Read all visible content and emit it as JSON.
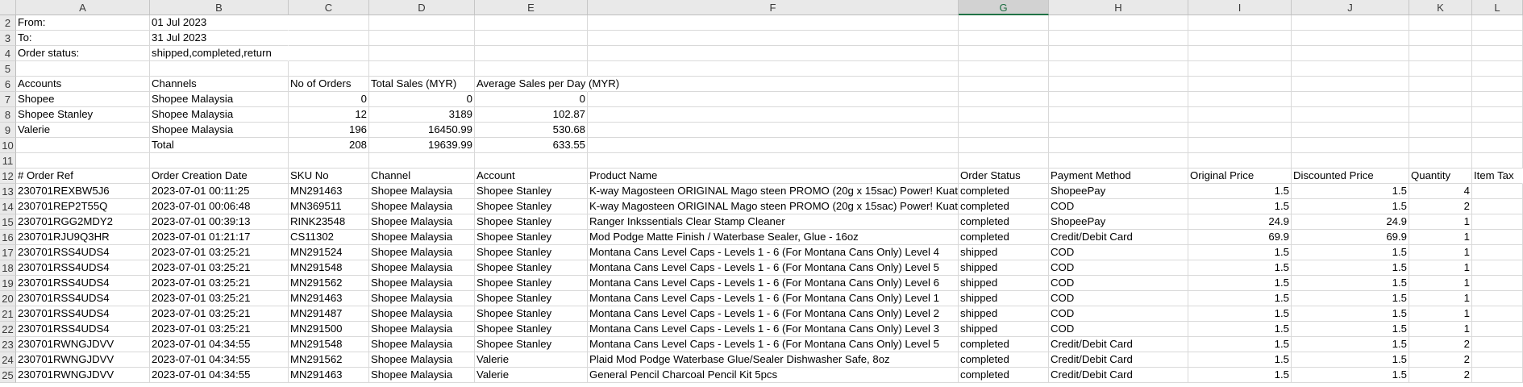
{
  "columns": [
    "A",
    "B",
    "C",
    "D",
    "E",
    "F",
    "G",
    "H",
    "I",
    "J",
    "K",
    "L"
  ],
  "selected_column": "G",
  "rows": [
    {
      "num": "2",
      "cells": [
        "From:",
        "01 Jul 2023",
        "",
        "",
        "",
        "",
        "",
        "",
        "",
        "",
        "",
        ""
      ]
    },
    {
      "num": "3",
      "cells": [
        "To:",
        "31 Jul 2023",
        "",
        "",
        "",
        "",
        "",
        "",
        "",
        "",
        "",
        ""
      ]
    },
    {
      "num": "4",
      "cells": [
        "Order status:",
        "shipped,completed,return",
        "",
        "",
        "",
        "",
        "",
        "",
        "",
        "",
        "",
        ""
      ]
    },
    {
      "num": "5",
      "cells": [
        "",
        "",
        "",
        "",
        "",
        "",
        "",
        "",
        "",
        "",
        "",
        ""
      ]
    },
    {
      "num": "6",
      "cells": [
        "Accounts",
        "Channels",
        "No of Orders",
        "Total Sales (MYR)",
        "Average Sales per Day (MYR)",
        "",
        "",
        "",
        "",
        "",
        "",
        ""
      ]
    },
    {
      "num": "7",
      "cells": [
        "Shopee",
        "Shopee Malaysia",
        "0",
        "0",
        "0",
        "",
        "",
        "",
        "",
        "",
        "",
        ""
      ]
    },
    {
      "num": "8",
      "cells": [
        "Shopee Stanley",
        "Shopee Malaysia",
        "12",
        "3189",
        "102.87",
        "",
        "",
        "",
        "",
        "",
        "",
        ""
      ]
    },
    {
      "num": "9",
      "cells": [
        "Valerie",
        "Shopee Malaysia",
        "196",
        "16450.99",
        "530.68",
        "",
        "",
        "",
        "",
        "",
        "",
        ""
      ]
    },
    {
      "num": "10",
      "cells": [
        "",
        "Total",
        "208",
        "19639.99",
        "633.55",
        "",
        "",
        "",
        "",
        "",
        "",
        ""
      ]
    },
    {
      "num": "11",
      "cells": [
        "",
        "",
        "",
        "",
        "",
        "",
        "",
        "",
        "",
        "",
        "",
        ""
      ]
    },
    {
      "num": "12",
      "cells": [
        "# Order Ref",
        "Order Creation Date",
        "SKU No",
        "Channel",
        "Account",
        "Product Name",
        "Order Status",
        "Payment Method",
        "Original Price",
        "Discounted Price",
        "Quantity",
        "Item Tax"
      ]
    },
    {
      "num": "13",
      "cells": [
        "230701REXBW5J6",
        "2023-07-01 00:11:25",
        "MN291463",
        "Shopee Malaysia",
        "Shopee Stanley",
        "K-way Magosteen ORIGINAL Mago steen PROMO (20g x 15sac) Power! Kuat",
        "completed",
        "ShopeePay",
        "1.5",
        "1.5",
        "4",
        ""
      ]
    },
    {
      "num": "14",
      "cells": [
        "230701REP2T55Q",
        "2023-07-01 00:06:48",
        "MN369511",
        "Shopee Malaysia",
        "Shopee Stanley",
        "K-way Magosteen ORIGINAL Mago steen PROMO (20g x 15sac) Power! Kuat",
        "completed",
        "COD",
        "1.5",
        "1.5",
        "2",
        ""
      ]
    },
    {
      "num": "15",
      "cells": [
        "230701RGG2MDY2",
        "2023-07-01 00:39:13",
        "RINK23548",
        "Shopee Malaysia",
        "Shopee Stanley",
        "Ranger Inkssentials Clear Stamp Cleaner",
        "completed",
        "ShopeePay",
        "24.9",
        "24.9",
        "1",
        ""
      ]
    },
    {
      "num": "16",
      "cells": [
        "230701RJU9Q3HR",
        "2023-07-01 01:21:17",
        "CS11302",
        "Shopee Malaysia",
        "Shopee Stanley",
        "Mod Podge Matte Finish / Waterbase Sealer, Glue - 16oz",
        "completed",
        "Credit/Debit Card",
        "69.9",
        "69.9",
        "1",
        ""
      ]
    },
    {
      "num": "17",
      "cells": [
        "230701RSS4UDS4",
        "2023-07-01 03:25:21",
        "MN291524",
        "Shopee Malaysia",
        "Shopee Stanley",
        "Montana Cans Level Caps - Levels 1 - 6 (For Montana Cans Only) Level 4",
        "shipped",
        "COD",
        "1.5",
        "1.5",
        "1",
        ""
      ]
    },
    {
      "num": "18",
      "cells": [
        "230701RSS4UDS4",
        "2023-07-01 03:25:21",
        "MN291548",
        "Shopee Malaysia",
        "Shopee Stanley",
        "Montana Cans Level Caps - Levels 1 - 6 (For Montana Cans Only) Level 5",
        "shipped",
        "COD",
        "1.5",
        "1.5",
        "1",
        ""
      ]
    },
    {
      "num": "19",
      "cells": [
        "230701RSS4UDS4",
        "2023-07-01 03:25:21",
        "MN291562",
        "Shopee Malaysia",
        "Shopee Stanley",
        "Montana Cans Level Caps - Levels 1 - 6 (For Montana Cans Only) Level 6",
        "shipped",
        "COD",
        "1.5",
        "1.5",
        "1",
        ""
      ]
    },
    {
      "num": "20",
      "cells": [
        "230701RSS4UDS4",
        "2023-07-01 03:25:21",
        "MN291463",
        "Shopee Malaysia",
        "Shopee Stanley",
        "Montana Cans Level Caps - Levels 1 - 6 (For Montana Cans Only) Level 1",
        "shipped",
        "COD",
        "1.5",
        "1.5",
        "1",
        ""
      ]
    },
    {
      "num": "21",
      "cells": [
        "230701RSS4UDS4",
        "2023-07-01 03:25:21",
        "MN291487",
        "Shopee Malaysia",
        "Shopee Stanley",
        "Montana Cans Level Caps - Levels 1 - 6 (For Montana Cans Only) Level 2",
        "shipped",
        "COD",
        "1.5",
        "1.5",
        "1",
        ""
      ]
    },
    {
      "num": "22",
      "cells": [
        "230701RSS4UDS4",
        "2023-07-01 03:25:21",
        "MN291500",
        "Shopee Malaysia",
        "Shopee Stanley",
        "Montana Cans Level Caps - Levels 1 - 6 (For Montana Cans Only) Level 3",
        "shipped",
        "COD",
        "1.5",
        "1.5",
        "1",
        ""
      ]
    },
    {
      "num": "23",
      "cells": [
        "230701RWNGJDVV",
        "2023-07-01 04:34:55",
        "MN291548",
        "Shopee Malaysia",
        "Shopee Stanley",
        "Montana Cans Level Caps - Levels 1 - 6 (For Montana Cans Only) Level 5",
        "completed",
        "Credit/Debit Card",
        "1.5",
        "1.5",
        "2",
        ""
      ]
    },
    {
      "num": "24",
      "cells": [
        "230701RWNGJDVV",
        "2023-07-01 04:34:55",
        "MN291562",
        "Shopee Malaysia",
        "Valerie",
        "Plaid Mod Podge Waterbase Glue/Sealer Dishwasher Safe, 8oz",
        "completed",
        "Credit/Debit Card",
        "1.5",
        "1.5",
        "2",
        ""
      ]
    },
    {
      "num": "25",
      "cells": [
        "230701RWNGJDVV",
        "2023-07-01 04:34:55",
        "MN291463",
        "Shopee Malaysia",
        "Valerie",
        "General Pencil Charcoal Pencil Kit 5pcs",
        "completed",
        "Credit/Debit Card",
        "1.5",
        "1.5",
        "2",
        ""
      ]
    }
  ]
}
